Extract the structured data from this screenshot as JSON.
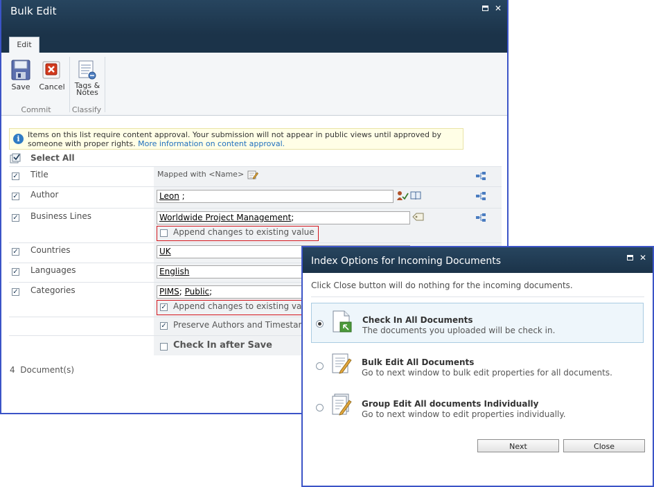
{
  "bulk_window": {
    "title": "Bulk Edit",
    "tabs": [
      {
        "label": "Edit"
      }
    ],
    "ribbon": {
      "save_label": "Save",
      "cancel_label": "Cancel",
      "tags_label_1": "Tags &",
      "tags_label_2": "Notes",
      "group_commit": "Commit",
      "group_classify": "Classify"
    },
    "approval_notice": {
      "text": "Items on this list require content approval. Your submission will not appear in public views until approved by someone with proper rights.",
      "link": "More information on content approval."
    },
    "select_all_label": "Select All",
    "fields": [
      {
        "label": "Title",
        "value": "Mapped with <Name>"
      },
      {
        "label": "Author",
        "value_name": "Leon",
        "value_suffix": " ;"
      },
      {
        "label": "Business Lines",
        "value_name": "Worldwide Project Management",
        "value_suffix": ";",
        "append_label": "Append changes to existing value"
      },
      {
        "label": "Countries",
        "value_name": "UK"
      },
      {
        "label": "Languages",
        "value_name": "English"
      },
      {
        "label": "Categories",
        "value_name_1": "PIMS",
        "value_sep": "; ",
        "value_name_2": "Public",
        "value_suffix": ";",
        "append_label": "Append changes to existing valu"
      }
    ],
    "preserve_label": "Preserve Authors and Timestamp",
    "checkin_after_save_label": "Check In after Save",
    "document_count": "4  Document(s)"
  },
  "index_dialog": {
    "title": "Index Options for Incoming Documents",
    "note": "Click Close button will do nothing for the incoming documents.",
    "options": [
      {
        "title": "Check In All Documents",
        "desc": "The documents you uploaded will be check in.",
        "selected": true
      },
      {
        "title": "Bulk Edit All Documents",
        "desc": "Go to next window to bulk edit properties for all documents.",
        "selected": false
      },
      {
        "title": "Group Edit All documents Individually",
        "desc": "Go to next window to edit properties individually.",
        "selected": false
      }
    ],
    "next_label": "Next",
    "close_label": "Close"
  },
  "colors": {
    "title_bar": "#1e3952",
    "window_border": "#3b54c7",
    "highlight_red": "#d3141b",
    "link": "#1f6fbd"
  }
}
